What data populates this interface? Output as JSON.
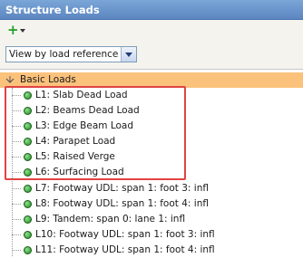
{
  "window": {
    "title": "Structure Loads"
  },
  "toolbar": {
    "add_label": "+"
  },
  "view_select": {
    "value": "View by load reference"
  },
  "tree": {
    "group_label": "Basic Loads",
    "items": [
      {
        "label": "L1: Slab Dead Load"
      },
      {
        "label": "L2: Beams Dead Load"
      },
      {
        "label": "L3: Edge Beam Load"
      },
      {
        "label": "L4: Parapet Load"
      },
      {
        "label": "L5: Raised Verge"
      },
      {
        "label": "L6: Surfacing Load"
      },
      {
        "label": "L7: Footway UDL: span 1: foot 3: infl"
      },
      {
        "label": "L8: Footway UDL: span 1: foot 4: infl"
      },
      {
        "label": "L9: Tandem: span 0: lane 1: infl"
      },
      {
        "label": "L10: Footway UDL: span 1: foot 3: infl"
      },
      {
        "label": "L11: Footway UDL: span 1: foot 4: infl"
      }
    ]
  },
  "colors": {
    "title_bar": "#6a96cc",
    "group_highlight": "#fbc27c",
    "annotation_box": "#e04343",
    "bullet": "#2aa02a"
  }
}
